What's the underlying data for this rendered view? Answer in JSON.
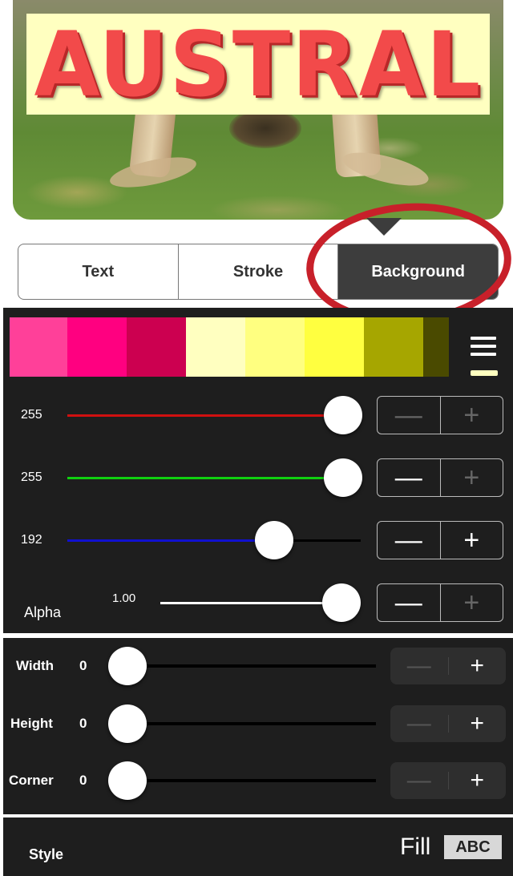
{
  "preview": {
    "title_text": "AUSTRAL",
    "title_color": "#f24a4a",
    "title_background": "#ffffc0"
  },
  "tabs": [
    {
      "label": "Text",
      "active": false
    },
    {
      "label": "Stroke",
      "active": false
    },
    {
      "label": "Background",
      "active": true
    }
  ],
  "swatches": [
    "#ff4099",
    "#ff0080",
    "#cc0050",
    "#ffffc0",
    "#ffff80",
    "#ffff40",
    "#a6a600",
    "#4a4a00"
  ],
  "current_color": "#ffffc0",
  "rgb": [
    {
      "name": "red",
      "value": "255",
      "level": 1.0,
      "color": "#d01010",
      "minus": "—",
      "plus": "+"
    },
    {
      "name": "green",
      "value": "255",
      "level": 1.0,
      "color": "#10d010",
      "minus": "—",
      "plus": "+"
    },
    {
      "name": "blue",
      "value": "192",
      "level": 0.75,
      "color": "#1010d0",
      "minus": "—",
      "plus": "+"
    }
  ],
  "alpha": {
    "label": "Alpha",
    "value": "1.00",
    "level": 1.0,
    "minus": "—",
    "plus": "+"
  },
  "size": [
    {
      "label": "Width",
      "value": "0",
      "level": 0,
      "minus": "—",
      "plus": "+"
    },
    {
      "label": "Height",
      "value": "0",
      "level": 0,
      "minus": "—",
      "plus": "+"
    },
    {
      "label": "Corner",
      "value": "0",
      "level": 0,
      "minus": "—",
      "plus": "+"
    }
  ],
  "style": {
    "label": "Style",
    "fill_label": "Fill",
    "badge": "ABC"
  }
}
